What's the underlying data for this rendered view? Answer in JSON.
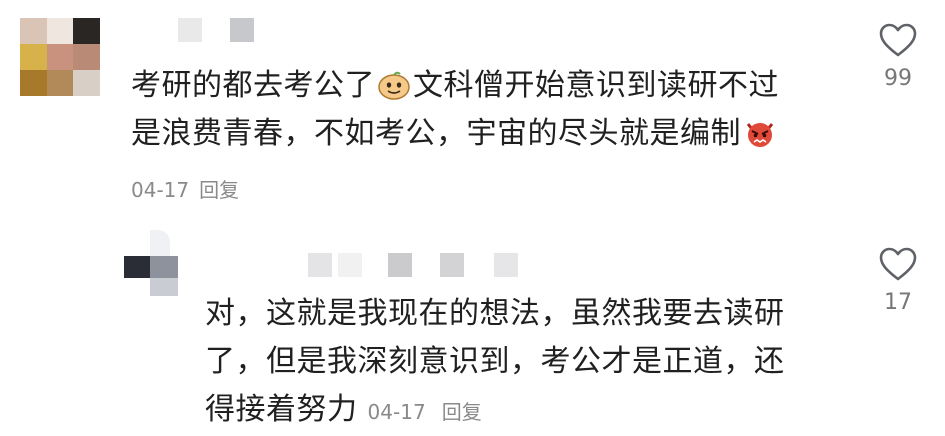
{
  "comments": [
    {
      "text_line1_a": "考研的都去考公了",
      "text_line1_b": "文科僧开始意识到读研不过",
      "text_line2": "是浪费青春，不如考公，宇宙的尽头就是编制",
      "emoji_inline": "smiling-face-emoji",
      "emoji_end": "angry-devil-emoji",
      "date": "04-17",
      "reply_label": "回复",
      "like_count": "99",
      "colors": {
        "avatar": [
          "#d9c4b6",
          "#efe6e0",
          "#2a2623",
          "#d7b24a",
          "#c9927f",
          "#b98a75",
          "#a67a2a",
          "#b28a5a",
          "#d8cfc7"
        ]
      }
    },
    {
      "text_line1": "对，这就是我现在的想法，虽然我要去读研",
      "text_line2": "了，但是我深刻意识到，考公才是正道，还",
      "text_line3": "得接着努力",
      "date": "04-17",
      "reply_label": "回复",
      "like_count": "17"
    }
  ],
  "icons": {
    "like": "heart-outline-icon"
  },
  "colors": {
    "text": "#202020",
    "meta": "#8a8a8a",
    "like_count": "#777777"
  }
}
